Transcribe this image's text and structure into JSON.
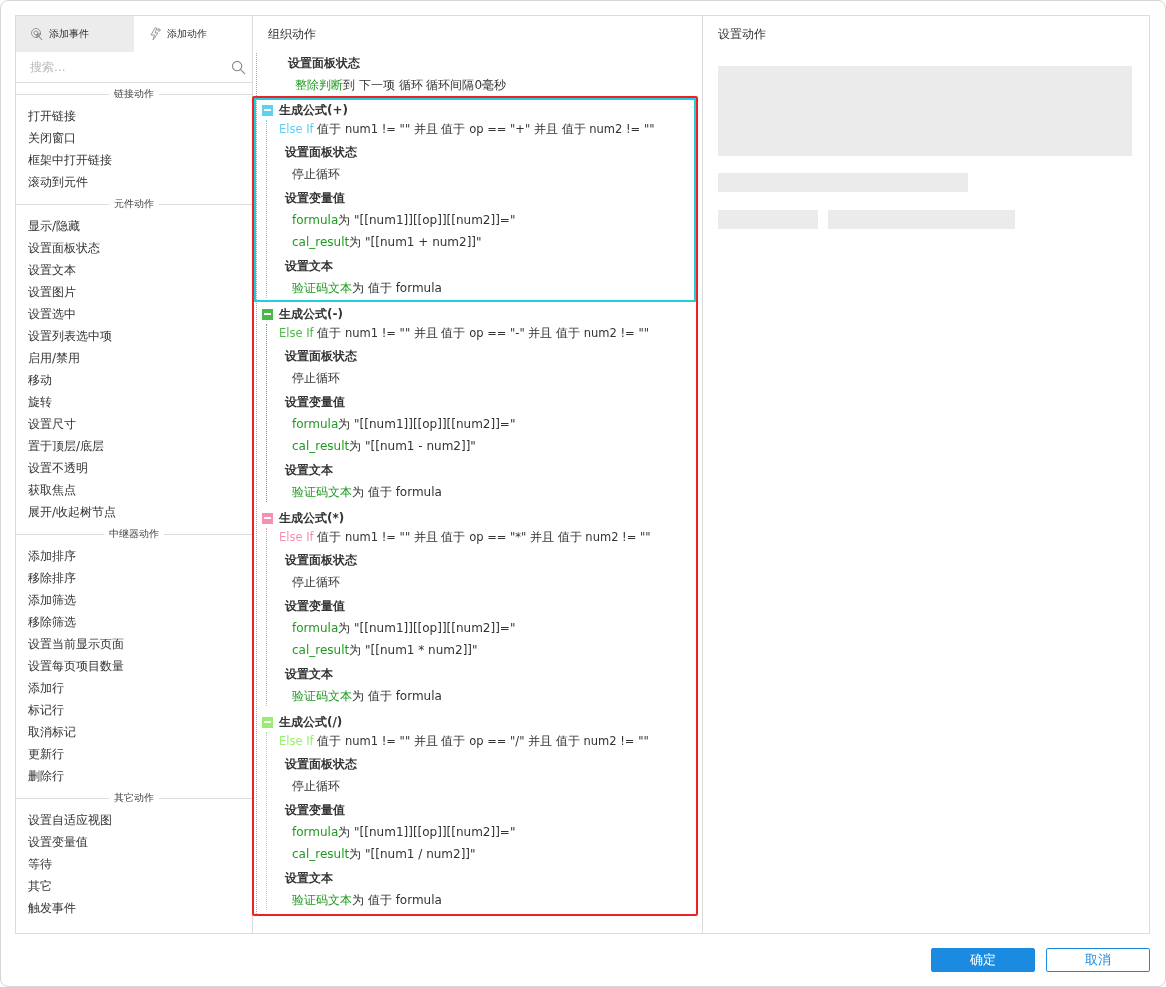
{
  "tabs": [
    {
      "label": "添加事件",
      "selected": false
    },
    {
      "label": "添加动作",
      "selected": true
    }
  ],
  "search": {
    "placeholder": "搜索..."
  },
  "sections": [
    {
      "title": "链接动作",
      "items": [
        "打开链接",
        "关闭窗口",
        "框架中打开链接",
        "滚动到元件"
      ]
    },
    {
      "title": "元件动作",
      "items": [
        "显示/隐藏",
        "设置面板状态",
        "设置文本",
        "设置图片",
        "设置选中",
        "设置列表选中项",
        "启用/禁用",
        "移动",
        "旋转",
        "设置尺寸",
        "置于顶层/底层",
        "设置不透明",
        "获取焦点",
        "展开/收起树节点"
      ]
    },
    {
      "title": "中继器动作",
      "items": [
        "添加排序",
        "移除排序",
        "添加筛选",
        "移除筛选",
        "设置当前显示页面",
        "设置每页项目数量",
        "添加行",
        "标记行",
        "取消标记",
        "更新行",
        "删除行"
      ]
    },
    {
      "title": "其它动作",
      "items": [
        "设置自适应视图",
        "设置变量值",
        "等待",
        "其它",
        "触发事件"
      ]
    }
  ],
  "organize": {
    "title": "组织动作",
    "top_action": {
      "heading": "设置面板状态",
      "lines": [
        {
          "target": "整除判断",
          "text": "到 下一项 循环 循环间隔0毫秒"
        }
      ]
    },
    "cases": [
      {
        "name": "生成公式(+)",
        "color": "#5fd0f0",
        "selected": true,
        "keyword": "Else If",
        "condition": "值于 num1 != \"\" 并且 值于 op == \"+\" 并且 值于 num2 != \"\"",
        "actions": [
          {
            "heading": "设置面板状态",
            "lines": [
              {
                "text": "停止循环"
              }
            ]
          },
          {
            "heading": "设置变量值",
            "lines": [
              {
                "target": "formula",
                "text": "为 \"[[num1]][[op]][[num2]]=\""
              },
              {
                "target": "cal_result",
                "text": "为 \"[[num1 + num2]]\""
              }
            ]
          },
          {
            "heading": "设置文本",
            "lines": [
              {
                "target": "验证码文本",
                "text": "为 值于 formula"
              }
            ]
          }
        ]
      },
      {
        "name": "生成公式(-)",
        "color": "#4cb848",
        "selected": false,
        "keyword": "Else If",
        "condition": "值于 num1 != \"\" 并且 值于 op == \"-\" 并且 值于 num2 != \"\"",
        "actions": [
          {
            "heading": "设置面板状态",
            "lines": [
              {
                "text": "停止循环"
              }
            ]
          },
          {
            "heading": "设置变量值",
            "lines": [
              {
                "target": "formula",
                "text": "为 \"[[num1]][[op]][[num2]]=\""
              },
              {
                "target": "cal_result",
                "text": "为 \"[[num1 - num2]]\""
              }
            ]
          },
          {
            "heading": "设置文本",
            "lines": [
              {
                "target": "验证码文本",
                "text": "为 值于 formula"
              }
            ]
          }
        ]
      },
      {
        "name": "生成公式(*)",
        "color": "#f590b4",
        "selected": false,
        "keyword": "Else If",
        "condition": "值于 num1 != \"\" 并且 值于 op == \"*\" 并且 值于 num2 != \"\"",
        "actions": [
          {
            "heading": "设置面板状态",
            "lines": [
              {
                "text": "停止循环"
              }
            ]
          },
          {
            "heading": "设置变量值",
            "lines": [
              {
                "target": "formula",
                "text": "为 \"[[num1]][[op]][[num2]]=\""
              },
              {
                "target": "cal_result",
                "text": "为 \"[[num1 * num2]]\""
              }
            ]
          },
          {
            "heading": "设置文本",
            "lines": [
              {
                "target": "验证码文本",
                "text": "为 值于 formula"
              }
            ]
          }
        ]
      },
      {
        "name": "生成公式(/)",
        "color": "#99ee70",
        "selected": false,
        "keyword": "Else If",
        "condition": "值于 num1 != \"\" 并且 值于 op == \"/\" 并且 值于 num2 != \"\"",
        "actions": [
          {
            "heading": "设置面板状态",
            "lines": [
              {
                "text": "停止循环"
              }
            ]
          },
          {
            "heading": "设置变量值",
            "lines": [
              {
                "target": "formula",
                "text": "为 \"[[num1]][[op]][[num2]]=\""
              },
              {
                "target": "cal_result",
                "text": "为 \"[[num1 / num2]]\""
              }
            ]
          },
          {
            "heading": "设置文本",
            "lines": [
              {
                "target": "验证码文本",
                "text": "为 值于 formula"
              }
            ]
          }
        ]
      }
    ]
  },
  "settings": {
    "title": "设置动作"
  },
  "buttons": [
    {
      "label": "确定",
      "kind": "primary"
    },
    {
      "label": "取消",
      "kind": "secondary"
    }
  ]
}
